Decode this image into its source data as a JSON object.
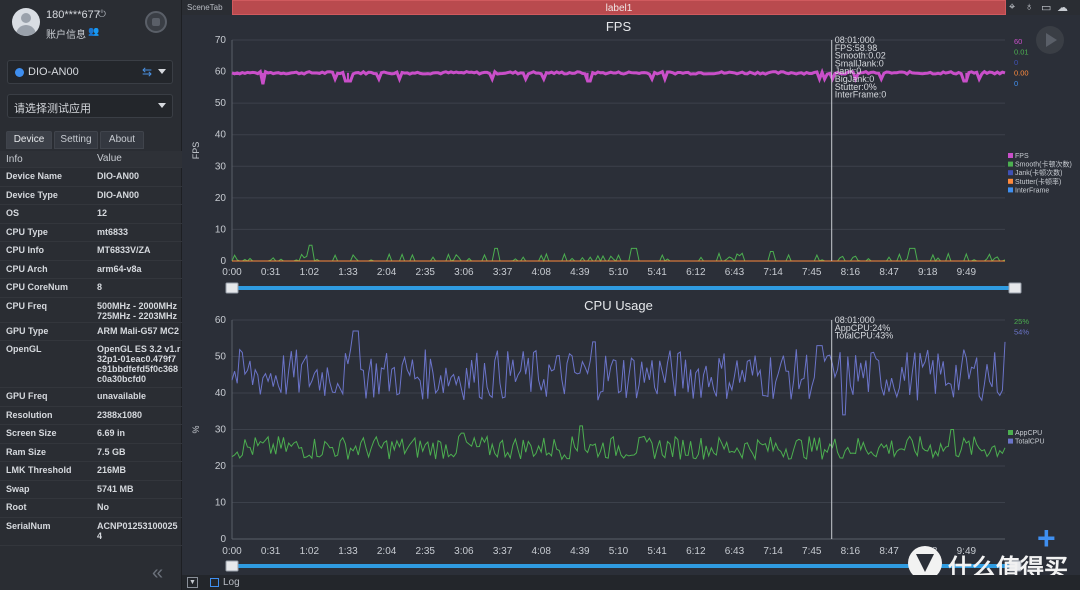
{
  "user": {
    "name": "180****677",
    "power_glyph": "⏻",
    "account_info": "账户信息",
    "account_glyph": "👥"
  },
  "device_select": {
    "value": "DIO-AN00",
    "link_glyph": "⇆"
  },
  "app_select": {
    "value": "请选择测试应用"
  },
  "tabs": [
    {
      "label": "Device"
    },
    {
      "label": "Setting"
    },
    {
      "label": "About"
    }
  ],
  "info": {
    "header": {
      "key": "Info",
      "value": "Value"
    },
    "rows": [
      {
        "key": "Device Name",
        "value": "DIO-AN00"
      },
      {
        "key": "Device Type",
        "value": "DIO-AN00"
      },
      {
        "key": "OS",
        "value": "12"
      },
      {
        "key": "CPU Type",
        "value": "mt6833"
      },
      {
        "key": "CPU Info",
        "value": "MT6833V/ZA"
      },
      {
        "key": "CPU Arch",
        "value": "arm64-v8a"
      },
      {
        "key": "CPU CoreNum",
        "value": "8"
      },
      {
        "key": "CPU Freq",
        "value": "500MHz - 2000MHz 725MHz - 2203MHz"
      },
      {
        "key": "GPU Type",
        "value": "ARM Mali-G57 MC2"
      },
      {
        "key": "OpenGL",
        "value": "OpenGL ES 3.2 v1.r32p1-01eac0.479f7c91bbdfefd5f0c368c0a30bcfd0"
      },
      {
        "key": "GPU Freq",
        "value": "unavailable"
      },
      {
        "key": "Resolution",
        "value": "2388x1080"
      },
      {
        "key": "Screen Size",
        "value": "6.69 in"
      },
      {
        "key": "Ram Size",
        "value": "7.5 GB"
      },
      {
        "key": "LMK Threshold",
        "value": "216MB"
      },
      {
        "key": "Swap",
        "value": "5741 MB"
      },
      {
        "key": "Root",
        "value": "No"
      },
      {
        "key": "SerialNum",
        "value": "ACNP012531000254"
      }
    ]
  },
  "collapse_glyph": "«",
  "topbar": {
    "scene_tab": "SceneTab",
    "label_tab": "label1",
    "icons": [
      "location-icon",
      "pin-icon",
      "folder-icon",
      "cloud-icon"
    ],
    "icon_glyphs": [
      "⌖",
      "♁",
      "▭",
      "☁"
    ]
  },
  "bottombar": {
    "dropdown_glyph": "▼",
    "log_label": "Log"
  },
  "plus_glyph": "+",
  "watermark": "什么值得买",
  "colors": {
    "fps": "#c94fc9",
    "smooth": "#4caf50",
    "jank": "#3f51b5",
    "stutter": "#ff8a3d",
    "interframe": "#3f8ff0",
    "app_cpu": "#4caf50",
    "total_cpu": "#6b74c9",
    "slider": "#2f9be0"
  },
  "chart_data": [
    {
      "type": "line",
      "title": "FPS",
      "ylabel": "FPS",
      "ylim": [
        0,
        70
      ],
      "y_ticks": [
        "0",
        "10",
        "20",
        "30",
        "40",
        "50",
        "60",
        "70"
      ],
      "x_ticks": [
        "0:00",
        "0:31",
        "1:02",
        "1:33",
        "2:04",
        "2:35",
        "3:06",
        "3:37",
        "4:08",
        "4:39",
        "5:10",
        "5:41",
        "6:12",
        "6:43",
        "7:14",
        "7:45",
        "8:16",
        "8:47",
        "9:18",
        "9:49"
      ],
      "duration_s": 620,
      "cursor": {
        "time": "08:01:000",
        "lines": [
          "08:01:000",
          "FPS:58.98",
          "Smooth:0.02",
          "SmallJank:0",
          "Jank:0",
          "BigJank:0",
          "Stutter:0%",
          "InterFrame:0"
        ]
      },
      "right_values": [
        {
          "text": "60",
          "color": "#c94fc9"
        },
        {
          "text": "0.01",
          "color": "#4caf50"
        },
        {
          "text": "0",
          "color": "#3f51b5"
        },
        {
          "text": "0.00",
          "color": "#ff8a3d"
        },
        {
          "text": "0",
          "color": "#3f8ff0"
        }
      ],
      "legend": [
        {
          "name": "FPS",
          "color": "#c94fc9"
        },
        {
          "name": "Smooth(卡顿次数)",
          "color": "#4caf50"
        },
        {
          "name": "Jank(卡顿次数)",
          "color": "#3f51b5"
        },
        {
          "name": "Stutter(卡顿率)",
          "color": "#ff8a3d"
        },
        {
          "name": "InterFrame",
          "color": "#3f8ff0"
        }
      ],
      "legend_position": "right",
      "series": [
        {
          "name": "FPS",
          "mean": 59.6,
          "noise": 0.8,
          "dips": [
            [
              0.04,
              56
            ],
            [
              0.15,
              57
            ],
            [
              0.46,
              57
            ],
            [
              0.95,
              57
            ]
          ]
        },
        {
          "name": "Smooth",
          "mean": 0.6,
          "noise": 2.5,
          "spikes": [
            [
              0.1,
              5
            ],
            [
              0.34,
              4
            ],
            [
              0.52,
              4
            ],
            [
              0.7,
              3
            ],
            [
              0.88,
              4
            ]
          ]
        },
        {
          "name": "Stutter",
          "mean": 0,
          "noise": 0
        }
      ]
    },
    {
      "type": "line",
      "title": "CPU Usage",
      "ylabel": "%",
      "ylim": [
        0,
        60
      ],
      "y_ticks": [
        "0",
        "10",
        "20",
        "30",
        "40",
        "50",
        "60"
      ],
      "x_ticks": [
        "0:00",
        "0:31",
        "1:02",
        "1:33",
        "2:04",
        "2:35",
        "3:06",
        "3:37",
        "4:08",
        "4:39",
        "5:10",
        "5:41",
        "6:12",
        "6:43",
        "7:14",
        "7:45",
        "8:16",
        "8:47",
        "9:18",
        "9:49"
      ],
      "duration_s": 620,
      "cursor": {
        "time": "08:01:000",
        "lines": [
          "08:01:000",
          "AppCPU:24%",
          "TotalCPU:43%"
        ]
      },
      "right_values": [
        {
          "text": "25%",
          "color": "#4caf50"
        },
        {
          "text": "54%",
          "color": "#6b74c9"
        }
      ],
      "legend": [
        {
          "name": "AppCPU",
          "color": "#4caf50"
        },
        {
          "name": "TotalCPU",
          "color": "#6b74c9"
        }
      ],
      "legend_position": "right",
      "series": [
        {
          "name": "AppCPU",
          "mean": 25,
          "noise": 3.2,
          "spikes": [
            [
              0.45,
              31
            ],
            [
              0.3,
              29
            ],
            [
              0.93,
              30
            ]
          ],
          "end": 25
        },
        {
          "name": "TotalCPU",
          "mean": 45,
          "noise": 7,
          "spikes": [
            [
              0.16,
              57
            ],
            [
              0.47,
              54
            ],
            [
              0.76,
              53
            ],
            [
              0.79,
              34
            ]
          ],
          "end": 54
        }
      ]
    }
  ]
}
